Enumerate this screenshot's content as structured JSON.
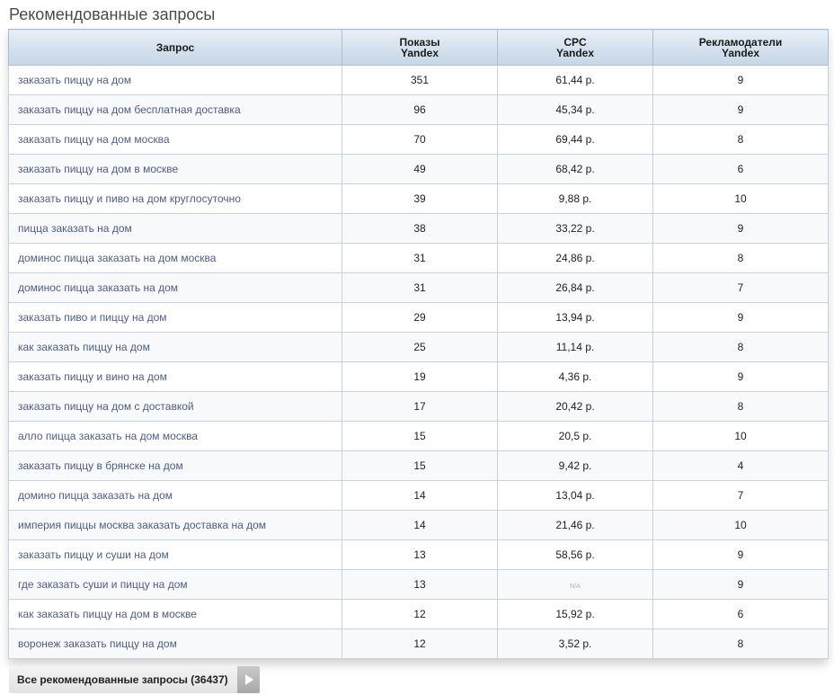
{
  "section": {
    "title": "Рекомендованные запросы"
  },
  "table": {
    "headers": {
      "query": "Запрос",
      "shows_line1": "Показы",
      "shows_line2": "Yandex",
      "cpc_line1": "CPC",
      "cpc_line2": "Yandex",
      "advertisers_line1": "Рекламодатели",
      "advertisers_line2": "Yandex"
    },
    "rows": [
      {
        "query": "заказать пиццу на дом",
        "shows": "351",
        "cpc": "61,44 р.",
        "advertisers": "9"
      },
      {
        "query": "заказать пиццу на дом бесплатная доставка",
        "shows": "96",
        "cpc": "45,34 р.",
        "advertisers": "9"
      },
      {
        "query": "заказать пиццу на дом москва",
        "shows": "70",
        "cpc": "69,44 р.",
        "advertisers": "8"
      },
      {
        "query": "заказать пиццу на дом в москве",
        "shows": "49",
        "cpc": "68,42 р.",
        "advertisers": "6"
      },
      {
        "query": "заказать пиццу и пиво на дом круглосуточно",
        "shows": "39",
        "cpc": "9,88 р.",
        "advertisers": "10"
      },
      {
        "query": "пицца заказать на дом",
        "shows": "38",
        "cpc": "33,22 р.",
        "advertisers": "9"
      },
      {
        "query": "доминос пицца заказать на дом москва",
        "shows": "31",
        "cpc": "24,86 р.",
        "advertisers": "8"
      },
      {
        "query": "доминос пицца заказать на дом",
        "shows": "31",
        "cpc": "26,84 р.",
        "advertisers": "7"
      },
      {
        "query": "заказать пиво и пиццу на дом",
        "shows": "29",
        "cpc": "13,94 р.",
        "advertisers": "9"
      },
      {
        "query": "как заказать пиццу на дом",
        "shows": "25",
        "cpc": "11,14 р.",
        "advertisers": "8"
      },
      {
        "query": "заказать пиццу и вино на дом",
        "shows": "19",
        "cpc": "4,36 р.",
        "advertisers": "9"
      },
      {
        "query": "заказать пиццу на дом с доставкой",
        "shows": "17",
        "cpc": "20,42 р.",
        "advertisers": "8"
      },
      {
        "query": "алло пицца заказать на дом москва",
        "shows": "15",
        "cpc": "20,5 р.",
        "advertisers": "10"
      },
      {
        "query": "заказать пиццу в брянске на дом",
        "shows": "15",
        "cpc": "9,42 р.",
        "advertisers": "4"
      },
      {
        "query": "домино пицца заказать на дом",
        "shows": "14",
        "cpc": "13,04 р.",
        "advertisers": "7"
      },
      {
        "query": "империя пиццы москва заказать доставка на дом",
        "shows": "14",
        "cpc": "21,46 р.",
        "advertisers": "10"
      },
      {
        "query": "заказать пиццу и суши на дом",
        "shows": "13",
        "cpc": "58,56 р.",
        "advertisers": "9"
      },
      {
        "query": "где заказать суши и пиццу на дом",
        "shows": "13",
        "cpc": "N/A",
        "advertisers": "9"
      },
      {
        "query": "как заказать пиццу на дом в москве",
        "shows": "12",
        "cpc": "15,92 р.",
        "advertisers": "6"
      },
      {
        "query": "воронеж заказать пиццу на дом",
        "shows": "12",
        "cpc": "3,52 р.",
        "advertisers": "8"
      }
    ]
  },
  "footer": {
    "all_button_label": "Все рекомендованные запросы (36437)",
    "arrow_icon": "play-arrow-icon"
  },
  "colors": {
    "header_bg": "#d3e0ec",
    "border": "#c5d3e0",
    "query_text": "#4e5d80"
  }
}
